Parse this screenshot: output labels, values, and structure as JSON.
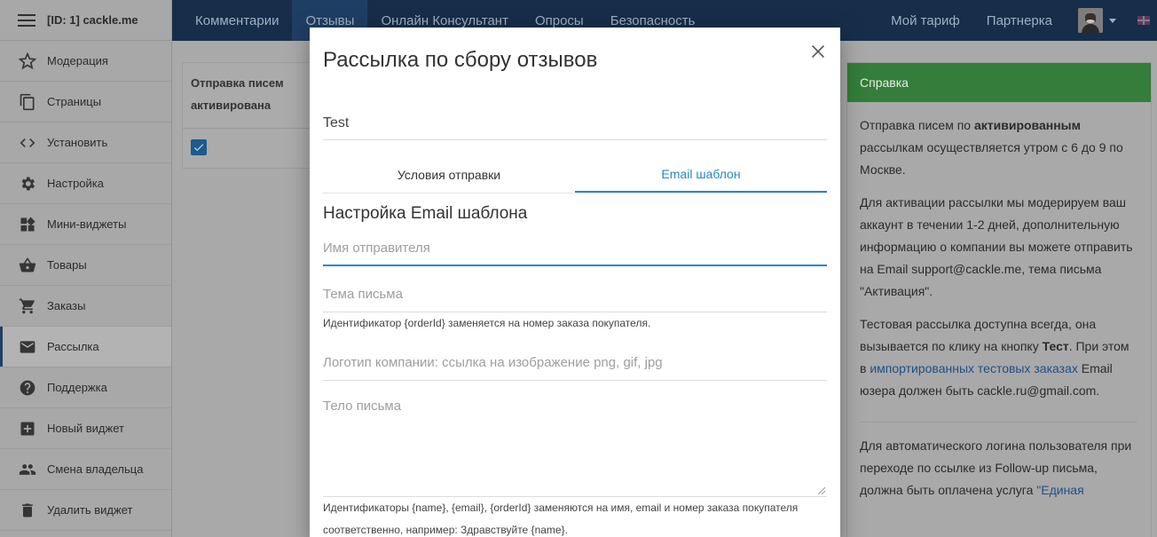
{
  "sidebar": {
    "title": "[ID: 1] cackle.me",
    "items": [
      {
        "label": "Модерация",
        "icon": "star-icon"
      },
      {
        "label": "Страницы",
        "icon": "pages-icon"
      },
      {
        "label": "Установить",
        "icon": "code-icon"
      },
      {
        "label": "Настройка",
        "icon": "gear-icon"
      },
      {
        "label": "Мини-виджеты",
        "icon": "widgets-icon"
      },
      {
        "label": "Товары",
        "icon": "basket-icon"
      },
      {
        "label": "Заказы",
        "icon": "cart-icon"
      },
      {
        "label": "Рассылка",
        "icon": "mail-icon",
        "active": true
      },
      {
        "label": "Поддержка",
        "icon": "help-icon"
      },
      {
        "label": "Новый виджет",
        "icon": "plus-box-icon"
      },
      {
        "label": "Смена владельца",
        "icon": "people-icon"
      },
      {
        "label": "Удалить виджет",
        "icon": "trash-icon"
      }
    ]
  },
  "topnav": {
    "items": [
      "Комментарии",
      "Отзывы",
      "Онлайн Консультант",
      "Опросы",
      "Безопасность"
    ],
    "active_index": 1,
    "right": [
      "Мой тариф",
      "Партнерка"
    ]
  },
  "bg_table": {
    "header": "Отправка писем активирована"
  },
  "help": {
    "title": "Справка",
    "p1_a": "Отправка писем по ",
    "p1_b": "активированным",
    "p1_c": " рассылкам осуществляется утром с 6 до 9 по Москве.",
    "p2": "Для активации рассылки мы модерируем ваш аккаунт в течении 1-2 дней, дополнительную информацию о компании вы можете отправить на Email support@cackle.me, тема письма \"Активация\".",
    "p3_a": "Тестовая рассылка доступна всегда, она вызывается по клику на кнопку ",
    "p3_b": "Тест",
    "p3_c": ". При этом в ",
    "p3_link": "импортированных тестовых заказах",
    "p3_d": " Email юзера должен быть cackle.ru@gmail.com.",
    "p4_a": "Для автоматического логина пользователя при переходе по ссылке из Follow-up письма, должна быть оплачена услуга ",
    "p4_link": "\"Единая"
  },
  "modal": {
    "title": "Рассылка по сбору отзывов",
    "name_value": "Test",
    "tabs": [
      "Условия отправки",
      "Email шаблон"
    ],
    "active_tab": 1,
    "section_title": "Настройка Email шаблона",
    "sender_placeholder": "Имя отправителя",
    "subject_placeholder": "Тема письма",
    "subject_hint": "Идентификатор {orderId} заменяется на номер заказа покупателя.",
    "logo_placeholder": "Логотип компании: ссылка на изображение png, gif, jpg",
    "body_placeholder": "Тело письма",
    "body_hint": "Идентификаторы {name}, {email}, {orderId} заменяются на имя, email и номер заказа покупателя соответственно, например: Здравствуйте {name}."
  },
  "colors": {
    "nav_bg": "#162e4a",
    "accent": "#2587d4",
    "help_header": "#347d3a"
  }
}
